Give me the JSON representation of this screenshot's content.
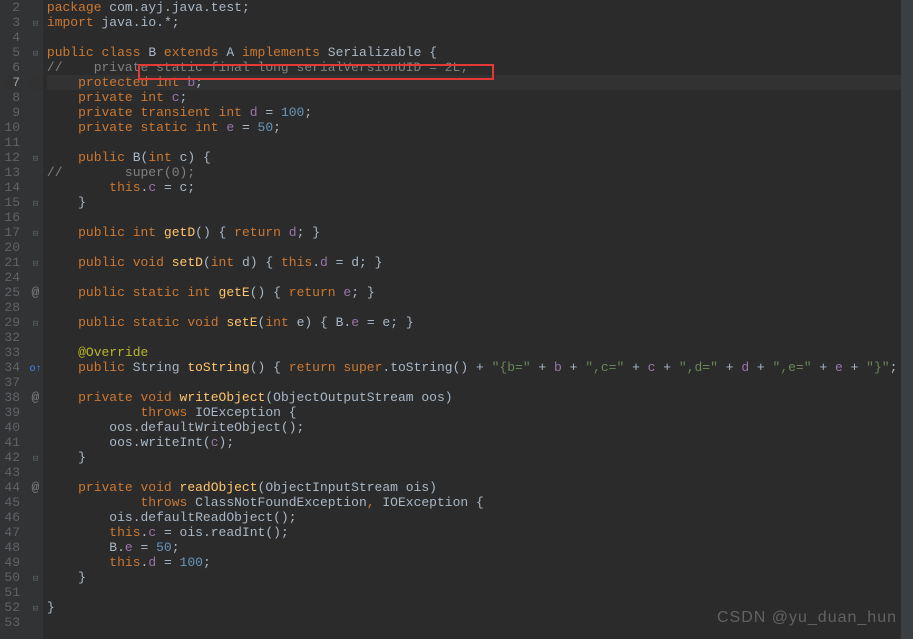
{
  "watermark": "CSDN @yu_duan_hun",
  "code_lines": [
    {
      "n": 2,
      "fold": "",
      "seg": [
        {
          "t": "package",
          "c": "kw"
        },
        {
          "t": " com",
          "c": ""
        },
        {
          "t": ".",
          "c": ""
        },
        {
          "t": "ayj",
          "c": ""
        },
        {
          "t": ".",
          "c": ""
        },
        {
          "t": "java",
          "c": ""
        },
        {
          "t": ".",
          "c": ""
        },
        {
          "t": "test",
          "c": ""
        },
        {
          "t": ";",
          "c": ""
        }
      ]
    },
    {
      "n": 3,
      "fold": "⊟",
      "seg": [
        {
          "t": "import",
          "c": "kw"
        },
        {
          "t": " java.",
          "c": ""
        },
        {
          "t": "io",
          "c": ""
        },
        {
          "t": ".",
          "c": ""
        },
        {
          "t": "*",
          "c": ""
        },
        {
          "t": ";",
          "c": ""
        }
      ]
    },
    {
      "n": 4,
      "fold": "",
      "seg": []
    },
    {
      "n": 5,
      "fold": "⊟",
      "seg": [
        {
          "t": "public class ",
          "c": "kw"
        },
        {
          "t": "B ",
          "c": "cls"
        },
        {
          "t": "extends ",
          "c": "kw"
        },
        {
          "t": "A ",
          "c": "cls"
        },
        {
          "t": "implements ",
          "c": "kw"
        },
        {
          "t": "Serializable ",
          "c": "cls"
        },
        {
          "t": "{",
          "c": "brace"
        }
      ]
    },
    {
      "n": 6,
      "fold": "",
      "seg": [
        {
          "t": "//    private static final long serialVersionUID = 2L;",
          "c": "comment"
        }
      ]
    },
    {
      "n": 7,
      "fold": "",
      "cur": true,
      "seg": [
        {
          "t": "    protected int ",
          "c": "kw"
        },
        {
          "t": "b",
          "c": "field"
        },
        {
          "t": ";",
          "c": ""
        }
      ]
    },
    {
      "n": 8,
      "fold": "",
      "seg": [
        {
          "t": "    private int ",
          "c": "kw"
        },
        {
          "t": "c",
          "c": "field"
        },
        {
          "t": ";",
          "c": ""
        }
      ]
    },
    {
      "n": 9,
      "fold": "",
      "seg": [
        {
          "t": "    private transient int ",
          "c": "kw"
        },
        {
          "t": "d ",
          "c": "field"
        },
        {
          "t": "= ",
          "c": ""
        },
        {
          "t": "100",
          "c": "num"
        },
        {
          "t": ";",
          "c": ""
        }
      ]
    },
    {
      "n": 10,
      "fold": "",
      "seg": [
        {
          "t": "    private static int ",
          "c": "kw"
        },
        {
          "t": "e ",
          "c": "field"
        },
        {
          "t": "= ",
          "c": ""
        },
        {
          "t": "50",
          "c": "num"
        },
        {
          "t": ";",
          "c": ""
        }
      ]
    },
    {
      "n": 11,
      "fold": "",
      "seg": []
    },
    {
      "n": 12,
      "fold": "⊟",
      "seg": [
        {
          "t": "    public ",
          "c": "kw"
        },
        {
          "t": "B",
          "c": "cls"
        },
        {
          "t": "(",
          "c": ""
        },
        {
          "t": "int ",
          "c": "kw"
        },
        {
          "t": "c) {",
          "c": ""
        }
      ]
    },
    {
      "n": 13,
      "fold": "",
      "seg": [
        {
          "t": "//        super(0);",
          "c": "comment"
        }
      ]
    },
    {
      "n": 14,
      "fold": "",
      "seg": [
        {
          "t": "        this",
          "c": "kw"
        },
        {
          "t": ".",
          "c": ""
        },
        {
          "t": "c ",
          "c": "field"
        },
        {
          "t": "= c;",
          "c": ""
        }
      ]
    },
    {
      "n": 15,
      "fold": "⊟",
      "seg": [
        {
          "t": "    }",
          "c": "brace"
        }
      ]
    },
    {
      "n": 16,
      "fold": "",
      "seg": []
    },
    {
      "n": 17,
      "fold": "⊟",
      "seg": [
        {
          "t": "    public int ",
          "c": "kw"
        },
        {
          "t": "getD",
          "c": "method"
        },
        {
          "t": "() ",
          "c": ""
        },
        {
          "t": "{",
          "c": "brace"
        },
        {
          "t": " return ",
          "c": "kw"
        },
        {
          "t": "d",
          "c": "field"
        },
        {
          "t": "; ",
          "c": ""
        },
        {
          "t": "}",
          "c": "brace"
        }
      ]
    },
    {
      "n": 20,
      "fold": "",
      "seg": []
    },
    {
      "n": 21,
      "fold": "⊟",
      "seg": [
        {
          "t": "    public void ",
          "c": "kw"
        },
        {
          "t": "setD",
          "c": "method"
        },
        {
          "t": "(",
          "c": ""
        },
        {
          "t": "int ",
          "c": "kw"
        },
        {
          "t": "d) ",
          "c": ""
        },
        {
          "t": "{",
          "c": "brace"
        },
        {
          "t": " this",
          "c": "kw"
        },
        {
          "t": ".",
          "c": ""
        },
        {
          "t": "d ",
          "c": "field"
        },
        {
          "t": "= d; ",
          "c": ""
        },
        {
          "t": "}",
          "c": "brace"
        }
      ]
    },
    {
      "n": 24,
      "fold": "",
      "seg": []
    },
    {
      "n": 25,
      "fold": "⊟",
      "icon": "@",
      "seg": [
        {
          "t": "    public static int ",
          "c": "kw"
        },
        {
          "t": "getE",
          "c": "method"
        },
        {
          "t": "() ",
          "c": ""
        },
        {
          "t": "{",
          "c": "brace"
        },
        {
          "t": " return ",
          "c": "kw"
        },
        {
          "t": "e",
          "c": "field"
        },
        {
          "t": "; ",
          "c": ""
        },
        {
          "t": "}",
          "c": "brace"
        }
      ]
    },
    {
      "n": 28,
      "fold": "",
      "seg": []
    },
    {
      "n": 29,
      "fold": "⊟",
      "seg": [
        {
          "t": "    public static void ",
          "c": "kw"
        },
        {
          "t": "setE",
          "c": "method"
        },
        {
          "t": "(",
          "c": ""
        },
        {
          "t": "int ",
          "c": "kw"
        },
        {
          "t": "e) ",
          "c": ""
        },
        {
          "t": "{",
          "c": "brace"
        },
        {
          "t": " B.",
          "c": ""
        },
        {
          "t": "e ",
          "c": "field"
        },
        {
          "t": "= e; ",
          "c": ""
        },
        {
          "t": "}",
          "c": "brace"
        }
      ]
    },
    {
      "n": 32,
      "fold": "",
      "seg": []
    },
    {
      "n": 33,
      "fold": "",
      "seg": [
        {
          "t": "    @Override",
          "c": "anno"
        }
      ]
    },
    {
      "n": 34,
      "fold": "⊟",
      "icon": "o↑",
      "seg": [
        {
          "t": "    public ",
          "c": "kw"
        },
        {
          "t": "String ",
          "c": "cls"
        },
        {
          "t": "toString",
          "c": "method"
        },
        {
          "t": "() ",
          "c": ""
        },
        {
          "t": "{",
          "c": "brace"
        },
        {
          "t": " return super",
          "c": "kw"
        },
        {
          "t": ".toString() + ",
          "c": ""
        },
        {
          "t": "\"{b=\"",
          "c": "str"
        },
        {
          "t": " + ",
          "c": ""
        },
        {
          "t": "b ",
          "c": "field"
        },
        {
          "t": "+ ",
          "c": ""
        },
        {
          "t": "\",c=\"",
          "c": "str"
        },
        {
          "t": " + ",
          "c": ""
        },
        {
          "t": "c ",
          "c": "field"
        },
        {
          "t": "+ ",
          "c": ""
        },
        {
          "t": "\",d=\"",
          "c": "str"
        },
        {
          "t": " + ",
          "c": ""
        },
        {
          "t": "d ",
          "c": "field"
        },
        {
          "t": "+ ",
          "c": ""
        },
        {
          "t": "\",e=\"",
          "c": "str"
        },
        {
          "t": " + ",
          "c": ""
        },
        {
          "t": "e ",
          "c": "field"
        },
        {
          "t": "+ ",
          "c": ""
        },
        {
          "t": "\"}\"",
          "c": "str"
        },
        {
          "t": "; ",
          "c": ""
        },
        {
          "t": "}",
          "c": "brace"
        }
      ]
    },
    {
      "n": 37,
      "fold": "",
      "seg": []
    },
    {
      "n": 38,
      "fold": "⊟",
      "icon": "@",
      "seg": [
        {
          "t": "    private void ",
          "c": "kw"
        },
        {
          "t": "writeObject",
          "c": "method"
        },
        {
          "t": "(ObjectOutputStream oos)",
          "c": ""
        }
      ]
    },
    {
      "n": 39,
      "fold": "",
      "seg": [
        {
          "t": "            throws ",
          "c": "kw"
        },
        {
          "t": "IOException {",
          "c": ""
        }
      ]
    },
    {
      "n": 40,
      "fold": "",
      "seg": [
        {
          "t": "        oos.defaultWriteObject();",
          "c": ""
        }
      ]
    },
    {
      "n": 41,
      "fold": "",
      "seg": [
        {
          "t": "        oos.writeInt(",
          "c": ""
        },
        {
          "t": "c",
          "c": "field"
        },
        {
          "t": ");",
          "c": ""
        }
      ]
    },
    {
      "n": 42,
      "fold": "⊟",
      "seg": [
        {
          "t": "    }",
          "c": "brace"
        }
      ]
    },
    {
      "n": 43,
      "fold": "",
      "seg": []
    },
    {
      "n": 44,
      "fold": "⊟",
      "icon": "@",
      "seg": [
        {
          "t": "    private void ",
          "c": "kw"
        },
        {
          "t": "readObject",
          "c": "method"
        },
        {
          "t": "(ObjectInputStream ois)",
          "c": ""
        }
      ]
    },
    {
      "n": 45,
      "fold": "",
      "seg": [
        {
          "t": "            throws ",
          "c": "kw"
        },
        {
          "t": "ClassNotFoundException",
          "c": ""
        },
        {
          "t": ", ",
          "c": "kw"
        },
        {
          "t": "IOException {",
          "c": ""
        }
      ]
    },
    {
      "n": 46,
      "fold": "",
      "seg": [
        {
          "t": "        ois.defaultReadObject();",
          "c": ""
        }
      ]
    },
    {
      "n": 47,
      "fold": "",
      "seg": [
        {
          "t": "        this",
          "c": "kw"
        },
        {
          "t": ".",
          "c": ""
        },
        {
          "t": "c ",
          "c": "field"
        },
        {
          "t": "= ois.readInt();",
          "c": ""
        }
      ]
    },
    {
      "n": 48,
      "fold": "",
      "seg": [
        {
          "t": "        B.",
          "c": ""
        },
        {
          "t": "e ",
          "c": "field"
        },
        {
          "t": "= ",
          "c": ""
        },
        {
          "t": "50",
          "c": "num"
        },
        {
          "t": ";",
          "c": ""
        }
      ]
    },
    {
      "n": 49,
      "fold": "",
      "seg": [
        {
          "t": "        this",
          "c": "kw"
        },
        {
          "t": ".",
          "c": ""
        },
        {
          "t": "d ",
          "c": "field"
        },
        {
          "t": "= ",
          "c": ""
        },
        {
          "t": "100",
          "c": "num"
        },
        {
          "t": ";",
          "c": ""
        }
      ]
    },
    {
      "n": 50,
      "fold": "⊟",
      "seg": [
        {
          "t": "    }",
          "c": "brace"
        }
      ]
    },
    {
      "n": 51,
      "fold": "",
      "seg": []
    },
    {
      "n": 52,
      "fold": "⊟",
      "seg": [
        {
          "t": "}",
          "c": "brace"
        }
      ]
    },
    {
      "n": 53,
      "fold": "",
      "seg": []
    }
  ]
}
